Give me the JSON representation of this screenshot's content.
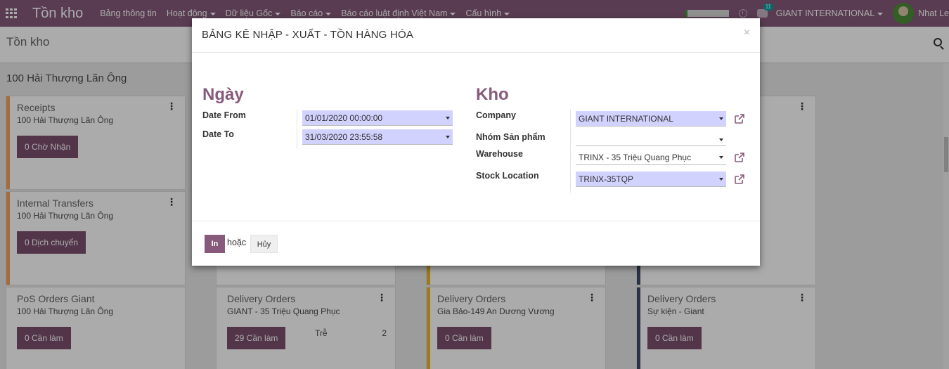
{
  "navbar": {
    "brand": "Tồn kho",
    "menu": [
      "Bảng thông tin",
      "Hoạt động",
      "Dữ liệu Gốc",
      "Báo cáo",
      "Báo cáo luật định Việt Nam",
      "Cấu hình"
    ],
    "menu_has_caret": [
      false,
      true,
      true,
      true,
      true,
      true
    ],
    "chat_badge": "11",
    "company": "GIANT INTERNATIONAL",
    "user": "Nhat Le"
  },
  "control_panel": {
    "breadcrumb": "Tồn kho"
  },
  "kanban": {
    "group_title": "100 Hải Thượng Lãn Ông",
    "cards": [
      {
        "title": "Receipts",
        "subtitle": "100 Hải Thượng Lãn Ông",
        "button": "0 Chờ Nhận",
        "color": "#f0a15d"
      },
      {
        "title": "Internal Transfers",
        "subtitle": "100 Hải Thượng Lãn Ông",
        "button": "0 Dịch chuyển",
        "color": "#f0a15d"
      },
      {
        "title": "PoS Orders Giant",
        "subtitle": "100 Hải Thượng Lãn Ông",
        "button": "0 Cần làm",
        "color": ""
      },
      {
        "title": "Delivery Orders",
        "subtitle": "GIANT - 35 Triệu Quang Phục",
        "button": "29 Cần làm",
        "late_label": "Trễ",
        "late_count": "2",
        "color": ""
      },
      {
        "title": "Delivery Orders",
        "subtitle": "Gia Bảo-149 An Dương Vương",
        "button": "0 Cần làm",
        "color": "#e8b923"
      },
      {
        "title": "Delivery Orders",
        "subtitle": "Sự kiện - Giant",
        "button": "0 Cần làm",
        "color": "#3f4b6b"
      }
    ]
  },
  "modal": {
    "title": "BẢNG KÊ NHẬP - XUẤT - TỒN HÀNG HÓA",
    "close": "×",
    "left_section": {
      "title": "Ngày",
      "date_from_label": "Date From",
      "date_from_value": "01/01/2020 00:00:00",
      "date_to_label": "Date To",
      "date_to_value": "31/03/2020 23:55:58"
    },
    "right_section": {
      "title": "Kho",
      "company_label": "Company",
      "company_value": "GIANT INTERNATIONAL",
      "product_group_label": "Nhóm Sản phẩm",
      "product_group_value": "",
      "warehouse_label": "Warehouse",
      "warehouse_value": "TRINX - 35 Triệu Quang Phục",
      "location_label": "Stock Location",
      "location_value": "TRINX-35TQP"
    },
    "footer": {
      "print": "In",
      "or": "hoặc",
      "cancel": "Hủy"
    }
  },
  "colors": {
    "brand": "#875a7b",
    "button": "#7c4f6f",
    "input_required": "#d2d2ff"
  }
}
